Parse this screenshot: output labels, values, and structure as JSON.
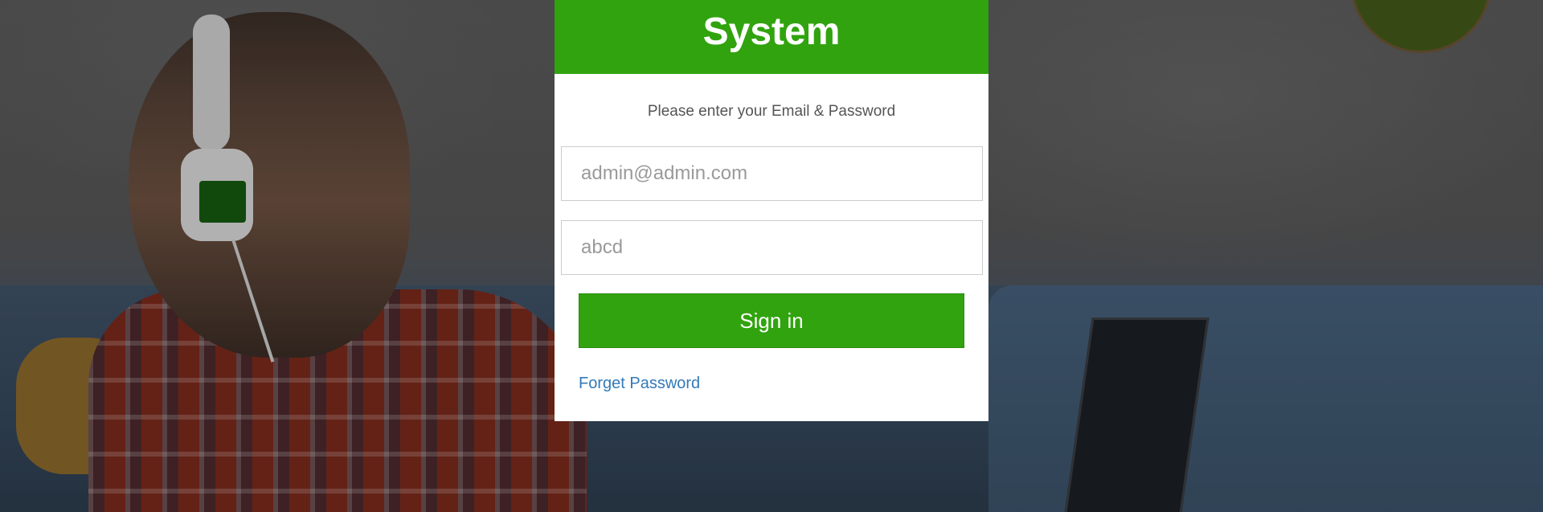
{
  "login": {
    "title": "System",
    "subtitle": "Please enter your Email & Password",
    "email_placeholder": "admin@admin.com",
    "password_placeholder": "abcd",
    "signin_label": "Sign in",
    "forget_label": "Forget Password"
  },
  "colors": {
    "brand_green": "#31a30f",
    "link_blue": "#337ab7"
  }
}
